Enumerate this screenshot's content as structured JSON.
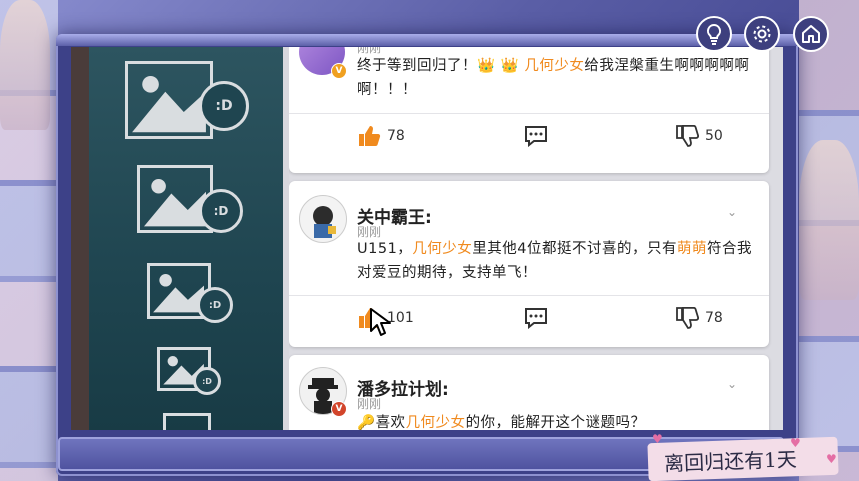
{
  "feed": {
    "posts": [
      {
        "username": "",
        "time": "刚刚",
        "text_parts": [
          "终于等到回归了！",
          "👑",
          " ",
          "👑",
          " ",
          "几何少女",
          "给我涅槃重生啊啊啊啊啊啊！！！"
        ],
        "likes": "78",
        "dislikes": "50"
      },
      {
        "username": "关中霸王:",
        "time": "刚刚",
        "text_parts": [
          "U151，",
          "几何少女",
          "里其他4位都挺不讨喜的，只有",
          "萌萌",
          "符合我对爱豆的期待，支持单飞！"
        ],
        "likes": "101",
        "dislikes": "78"
      },
      {
        "username": "潘多拉计划:",
        "time": "刚刚",
        "text_parts": [
          "🔑",
          "喜欢",
          "几何少女",
          "的你，能解开这个谜题吗？"
        ]
      }
    ]
  },
  "top_icons": [
    "hint-bulb-icon",
    "settings-gear-icon",
    "home-icon"
  ],
  "countdown": {
    "text": "离回归还有1天"
  },
  "colors": {
    "highlight": "#f08a1e",
    "frame": "#3d4188",
    "gallery": "#1f4550"
  }
}
